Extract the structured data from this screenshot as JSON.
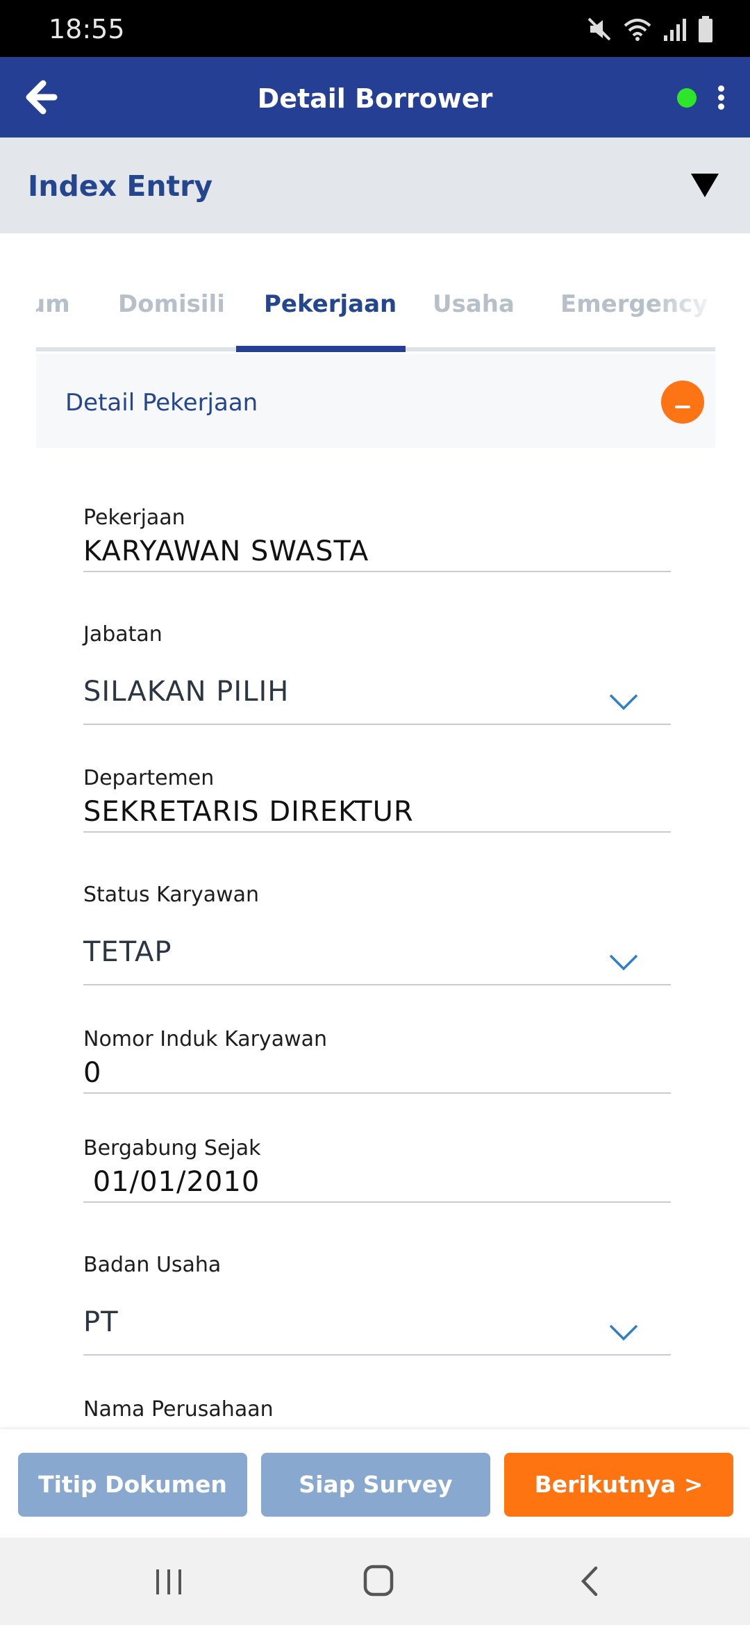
{
  "status_bar": {
    "time": "18:55",
    "icons": [
      "mute-icon",
      "wifi-icon",
      "signal-icon",
      "battery-icon"
    ]
  },
  "app_bar": {
    "title": "Detail Borrower",
    "online_color": "#2fe52a"
  },
  "index_entry": {
    "title": "Index Entry"
  },
  "tabs": [
    {
      "label": "Umum",
      "active": false
    },
    {
      "label": "Domisili",
      "active": false
    },
    {
      "label": "Pekerjaan",
      "active": true
    },
    {
      "label": "Usaha",
      "active": false
    },
    {
      "label": "Emergency",
      "active": false
    }
  ],
  "section": {
    "title": "Detail Pekerjaan"
  },
  "fields": [
    {
      "label": "Pekerjaan",
      "value": "KARYAWAN SWASTA",
      "type": "text"
    },
    {
      "label": "Jabatan",
      "value": "SILAKAN PILIH",
      "type": "select"
    },
    {
      "label": "Departemen",
      "value": "SEKRETARIS DIREKTUR",
      "type": "text"
    },
    {
      "label": "Status Karyawan",
      "value": "TETAP",
      "type": "select"
    },
    {
      "label": "Nomor Induk Karyawan",
      "value": "0",
      "type": "text"
    },
    {
      "label": "Bergabung Sejak",
      "value": " 01/01/2010",
      "type": "text"
    },
    {
      "label": "Badan Usaha",
      "value": "PT",
      "type": "select"
    },
    {
      "label": "Nama Perusahaan",
      "value": "",
      "type": "text"
    }
  ],
  "actions": {
    "titip_dokumen": "Titip Dokumen",
    "siap_survey": "Siap Survey",
    "berikutnya": "Berikutnya >"
  },
  "colors": {
    "primary": "#243f93",
    "accent": "#fd7411",
    "secondary_button": "#89a8d0"
  }
}
